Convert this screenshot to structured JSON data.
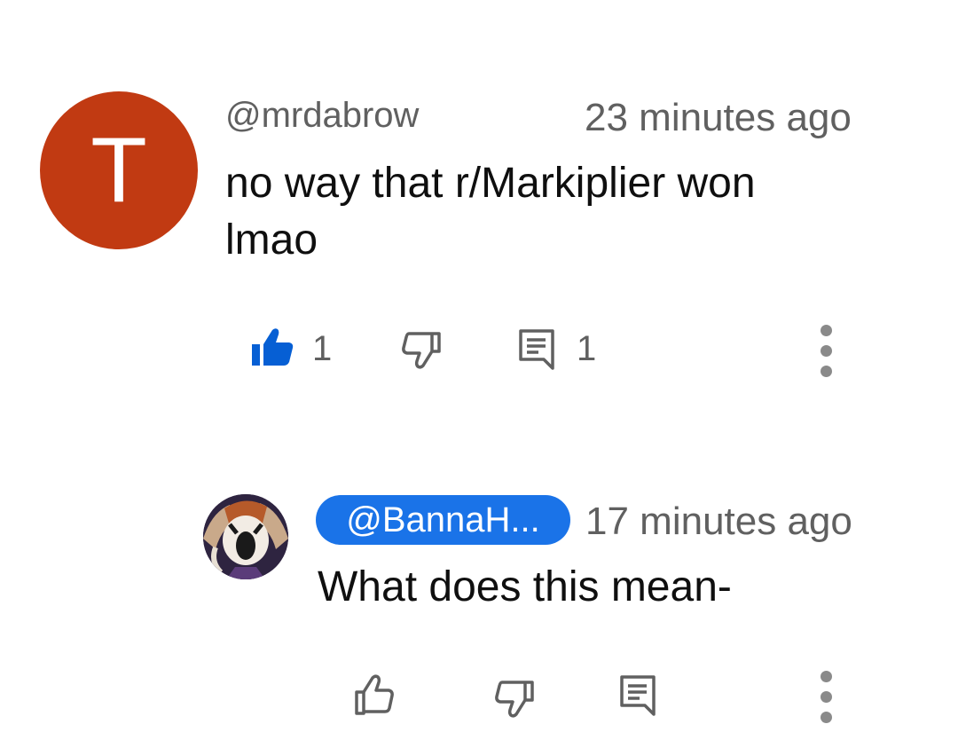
{
  "comment": {
    "avatar_letter": "T",
    "avatar_color": "#c13a12",
    "author": "@mrdabrow",
    "time": "23 minutes ago",
    "text": "no way that r/Markiplier won\nlmao",
    "likes": "1",
    "liked": true,
    "replies": "1",
    "icons": {
      "like": "thumbs-up-filled-icon",
      "dislike": "thumbs-down-icon",
      "reply": "reply-icon",
      "more": "more-vertical-icon"
    }
  },
  "reply": {
    "author": "@BannaH...",
    "author_badge_color": "#1a73e8",
    "time": "17 minutes ago",
    "text": "What does this mean-",
    "icons": {
      "like": "thumbs-up-icon",
      "dislike": "thumbs-down-icon",
      "reply": "reply-icon",
      "more": "more-vertical-icon"
    }
  },
  "colors": {
    "like_active": "#065fd4",
    "icon_gray": "#606060",
    "text": "#0f0f0f"
  }
}
